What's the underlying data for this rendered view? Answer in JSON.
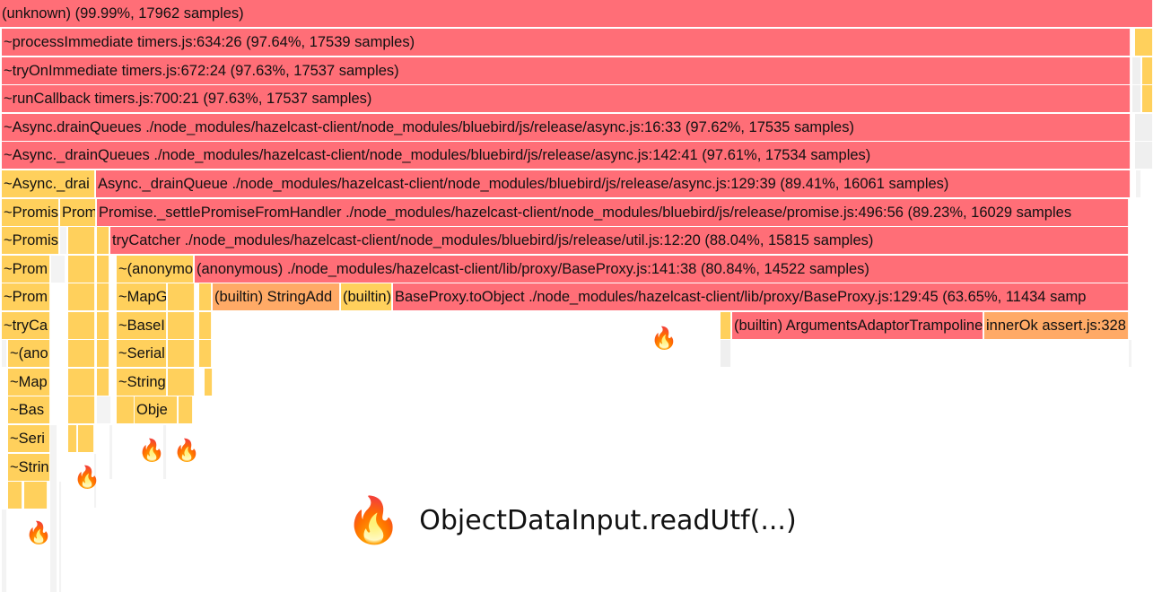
{
  "frames": {
    "root": "(unknown) (99.99%, 17962 samples)",
    "process_immediate": "~processImmediate timers.js:634:26 (97.64%, 17539 samples)",
    "try_on_immediate": "~tryOnImmediate timers.js:672:24 (97.63%, 17537 samples)",
    "run_callback": "~runCallback timers.js:700:21 (97.63%, 17537 samples)",
    "drain_queues": "~Async.drainQueues ./node_modules/hazelcast-client/node_modules/bluebird/js/release/async.js:16:33 (97.62%, 17535 samples)",
    "drain_queues_private": "~Async._drainQueues ./node_modules/hazelcast-client/node_modules/bluebird/js/release/async.js:142:41 (97.61%, 17534 samples)",
    "drain_queue_short": "~Async._drai",
    "drain_queue": "Async._drainQueue ./node_modules/hazelcast-client/node_modules/bluebird/js/release/async.js:129:39 (89.41%, 16061 samples)",
    "promise_short_a": "~Promis",
    "promise_short_b": "Prom",
    "settle_promise": "Promise._settlePromiseFromHandler ./node_modules/hazelcast-client/node_modules/bluebird/js/release/promise.js:496:56 (89.23%, 16029 samples",
    "promise_short_c": "~Promis",
    "try_catcher": "tryCatcher ./node_modules/hazelcast-client/node_modules/bluebird/js/release/util.js:12:20 (88.04%, 15815 samples)",
    "prom_short_d": "~Prom",
    "anon_short": "~(anonymo",
    "anon_baseproxy": "(anonymous) ./node_modules/hazelcast-client/lib/proxy/BaseProxy.js:141:38 (80.84%, 14522 samples)",
    "prom_short_e": "~Prom",
    "mapg_short": "~MapG",
    "string_add": "(builtin) StringAdd",
    "builtin_short": "(builtin)",
    "to_object": "BaseProxy.toObject ./node_modules/hazelcast-client/lib/proxy/BaseProxy.js:129:45 (63.65%, 11434 samp",
    "trycatch_short": "~tryCa",
    "basel_short": "~BaseI",
    "args_adaptor": "(builtin) ArgumentsAdaptorTrampoline",
    "inner_ok": "innerOk assert.js:328",
    "anon_short_2": "~(ano",
    "serial_short": "~Serial",
    "map_short": "~Map",
    "string_short": "~String",
    "bas_short": "~Bas",
    "obje_short": "Obje",
    "seri_short": "~Seri",
    "stri_short": "~Strin"
  },
  "flame_icon": "fire-icon",
  "flame_glyph": "🔥",
  "caption": "ObjectDataInput.readUtf(...)",
  "colors": {
    "hot": "#ff6e77",
    "warm": "#ffaa66",
    "gold": "#ffd05c"
  }
}
